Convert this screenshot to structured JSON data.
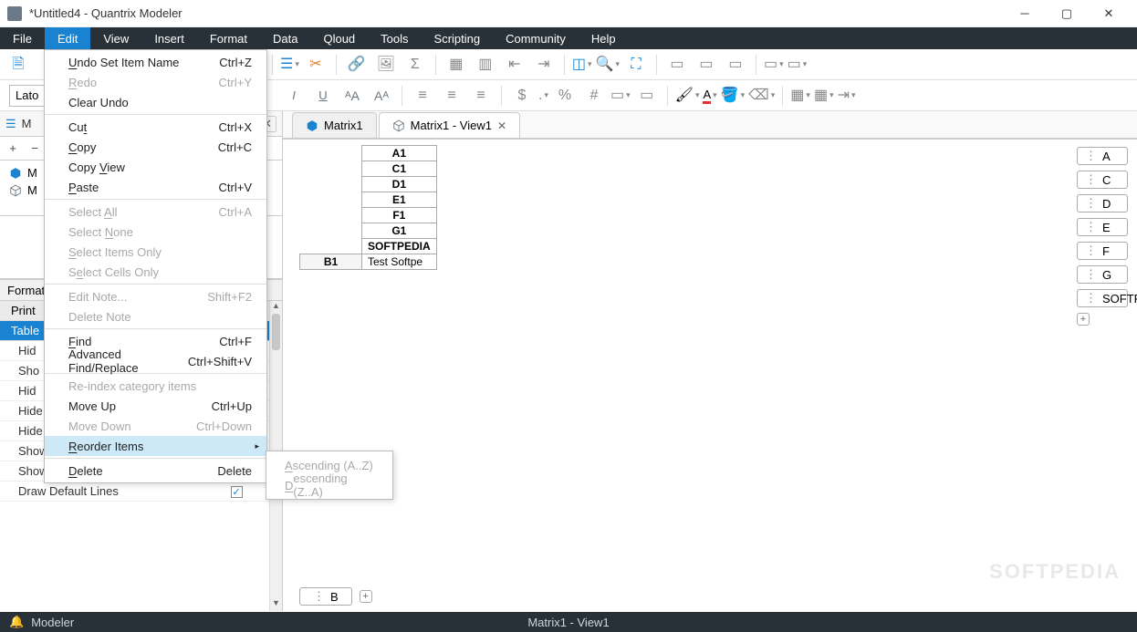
{
  "window": {
    "title": "*Untitled4 - Quantrix Modeler"
  },
  "menubar": [
    "File",
    "Edit",
    "View",
    "Insert",
    "Format",
    "Data",
    "Qloud",
    "Tools",
    "Scripting",
    "Community",
    "Help"
  ],
  "menubar_active": "Edit",
  "font_selector": "Lato",
  "tabs": [
    {
      "label": "Matrix1",
      "icon": "cube-solid",
      "closable": false
    },
    {
      "label": "Matrix1 - View1",
      "icon": "cube-wire",
      "closable": true,
      "active": true
    }
  ],
  "left": {
    "tabhdr": "M",
    "tools_plus": "+",
    "tools_minus": "−",
    "tree": [
      {
        "icon": "cube-solid",
        "label": "M"
      },
      {
        "icon": "cube-wire",
        "label": "M"
      }
    ],
    "formats_header": "Format",
    "cat_print": "Print",
    "cat_table": "Table",
    "rows": [
      {
        "label": "Hid",
        "kind": "text"
      },
      {
        "label": "Sho",
        "kind": "text"
      },
      {
        "label": "Hid",
        "kind": "text"
      },
      {
        "label": "Hide Empty Rows",
        "kind": "check",
        "checked": false
      },
      {
        "label": "Hide Empty Colum...",
        "kind": "check",
        "checked": false
      },
      {
        "label": "Show Row Header",
        "kind": "check",
        "checked": true
      },
      {
        "label": "Show Column Hea...",
        "kind": "check",
        "checked": true
      },
      {
        "label": "Draw Default Lines",
        "kind": "check",
        "checked": true
      }
    ]
  },
  "editmenu": {
    "groups": [
      [
        {
          "label": "Undo Set Item Name",
          "shortcut": "Ctrl+Z",
          "u": 0
        },
        {
          "label": "Redo",
          "shortcut": "Ctrl+Y",
          "u": 0,
          "disabled": true
        },
        {
          "label": "Clear Undo"
        }
      ],
      [
        {
          "label": "Cut",
          "shortcut": "Ctrl+X",
          "u": 2
        },
        {
          "label": "Copy",
          "shortcut": "Ctrl+C",
          "u": 0
        },
        {
          "label": "Copy View",
          "u": 5
        },
        {
          "label": "Paste",
          "shortcut": "Ctrl+V",
          "u": 0
        }
      ],
      [
        {
          "label": "Select All",
          "shortcut": "Ctrl+A",
          "u": 7,
          "disabled": true
        },
        {
          "label": "Select None",
          "u": 7,
          "disabled": true
        },
        {
          "label": "Select Items Only",
          "u": 0,
          "disabled": true
        },
        {
          "label": "Select Cells Only",
          "u": 1,
          "disabled": true
        }
      ],
      [
        {
          "label": "Edit Note...",
          "shortcut": "Shift+F2",
          "disabled": true
        },
        {
          "label": "Delete Note",
          "disabled": true
        }
      ],
      [
        {
          "label": "Find",
          "shortcut": "Ctrl+F",
          "u": 0
        },
        {
          "label": "Advanced Find/Replace",
          "shortcut": "Ctrl+Shift+V"
        }
      ],
      [
        {
          "label": "Re-index category items",
          "disabled": true
        },
        {
          "label": "Move Up",
          "shortcut": "Ctrl+Up"
        },
        {
          "label": "Move Down",
          "shortcut": "Ctrl+Down",
          "disabled": true
        },
        {
          "label": "Reorder Items",
          "submenu": true,
          "u": 0,
          "hover": true
        }
      ],
      [
        {
          "label": "Delete",
          "shortcut": "Delete",
          "u": 0
        }
      ]
    ],
    "submenu": [
      {
        "label": "Ascending (A..Z)",
        "u": 0
      },
      {
        "label": "Descending (Z..A)",
        "u": 0
      }
    ]
  },
  "matrix": {
    "col_headers": [
      "A1",
      "C1",
      "D1",
      "E1",
      "F1",
      "G1",
      "SOFTPEDIA"
    ],
    "row_header": "B1",
    "cell": "Test Softpe",
    "bottom_handle": "B",
    "right_handles": [
      "A",
      "C",
      "D",
      "E",
      "F",
      "G",
      "SOFTPEDIA"
    ]
  },
  "status": {
    "left": "Modeler",
    "mid": "Matrix1 - View1"
  },
  "watermark": "SOFTPEDIA"
}
